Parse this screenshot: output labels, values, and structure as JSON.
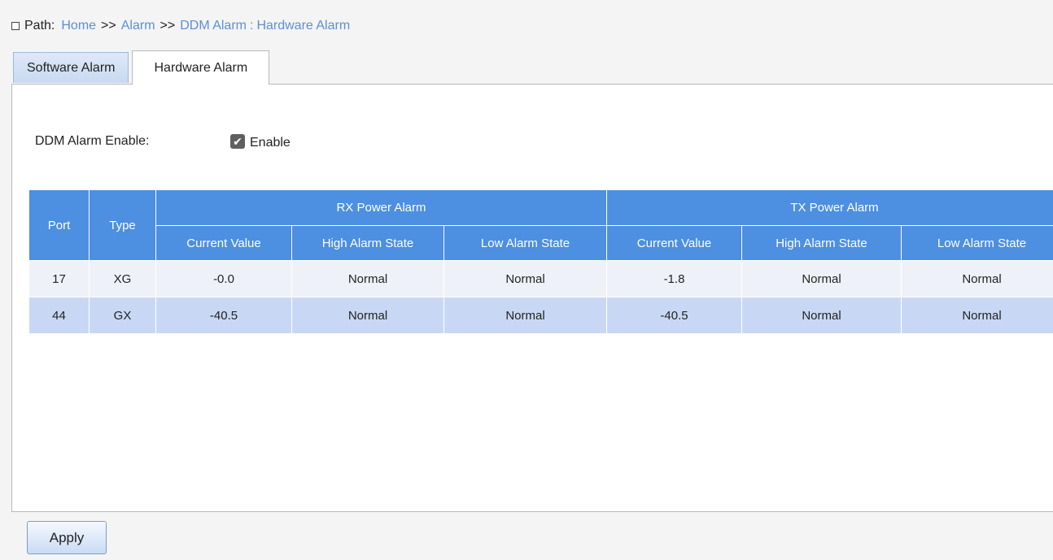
{
  "path": {
    "label": "Path:",
    "crumbs": [
      "Home",
      "Alarm",
      "DDM Alarm"
    ],
    "separator": ">>",
    "current_separator": ":",
    "current": "Hardware Alarm"
  },
  "tabs": [
    {
      "label": "Software Alarm",
      "active": false
    },
    {
      "label": "Hardware Alarm",
      "active": true
    }
  ],
  "ddm": {
    "label": "DDM Alarm Enable:",
    "checkbox_label": "Enable",
    "checked": true
  },
  "table": {
    "headers": {
      "port": "Port",
      "type": "Type",
      "rx_group": "RX Power Alarm",
      "tx_group": "TX Power Alarm",
      "sub": [
        "Current Value",
        "High Alarm State",
        "Low Alarm State",
        "Current Value",
        "High Alarm State",
        "Low Alarm State"
      ]
    },
    "rows": [
      {
        "port": "17",
        "type": "XG",
        "rx_current": "-0.0",
        "rx_high": "Normal",
        "rx_low": "Normal",
        "tx_current": "-1.8",
        "tx_high": "Normal",
        "tx_low": "Normal"
      },
      {
        "port": "44",
        "type": "GX",
        "rx_current": "-40.5",
        "rx_high": "Normal",
        "rx_low": "Normal",
        "tx_current": "-40.5",
        "tx_high": "Normal",
        "tx_low": "Normal"
      }
    ]
  },
  "buttons": {
    "apply": "Apply"
  },
  "colors": {
    "header_blue": "#4d8fe0",
    "row_alt": "#c8d8f4",
    "link": "#5b8fd6"
  }
}
